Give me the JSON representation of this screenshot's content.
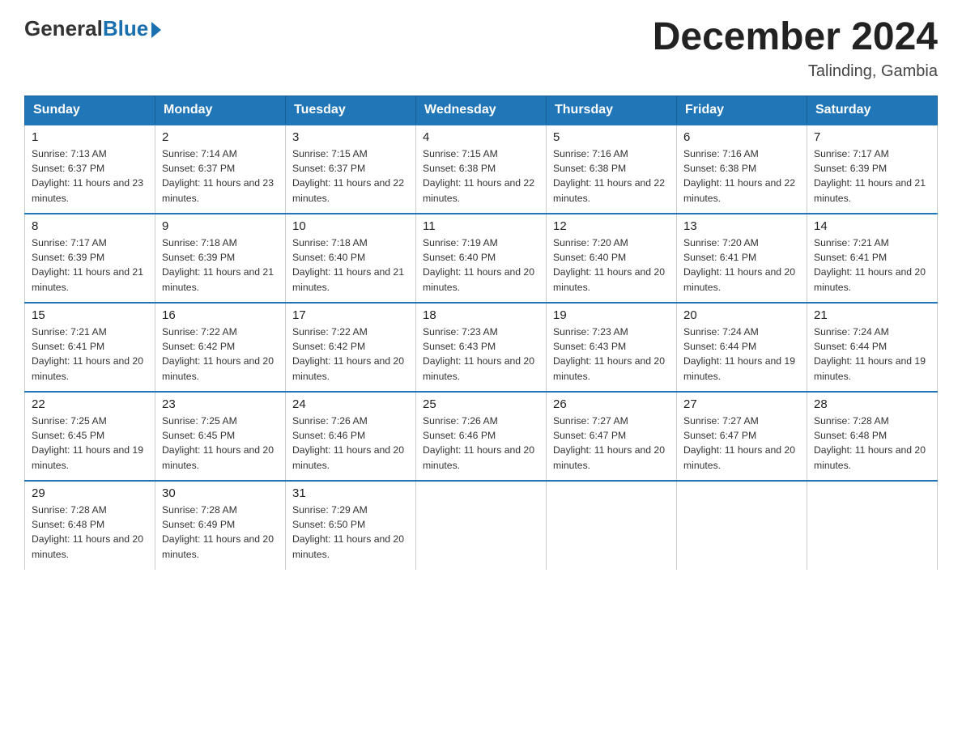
{
  "header": {
    "logo_general": "General",
    "logo_blue": "Blue",
    "month_title": "December 2024",
    "location": "Talinding, Gambia"
  },
  "weekdays": [
    "Sunday",
    "Monday",
    "Tuesday",
    "Wednesday",
    "Thursday",
    "Friday",
    "Saturday"
  ],
  "weeks": [
    [
      {
        "day": "1",
        "sunrise": "7:13 AM",
        "sunset": "6:37 PM",
        "daylight": "11 hours and 23 minutes."
      },
      {
        "day": "2",
        "sunrise": "7:14 AM",
        "sunset": "6:37 PM",
        "daylight": "11 hours and 23 minutes."
      },
      {
        "day": "3",
        "sunrise": "7:15 AM",
        "sunset": "6:37 PM",
        "daylight": "11 hours and 22 minutes."
      },
      {
        "day": "4",
        "sunrise": "7:15 AM",
        "sunset": "6:38 PM",
        "daylight": "11 hours and 22 minutes."
      },
      {
        "day": "5",
        "sunrise": "7:16 AM",
        "sunset": "6:38 PM",
        "daylight": "11 hours and 22 minutes."
      },
      {
        "day": "6",
        "sunrise": "7:16 AM",
        "sunset": "6:38 PM",
        "daylight": "11 hours and 22 minutes."
      },
      {
        "day": "7",
        "sunrise": "7:17 AM",
        "sunset": "6:39 PM",
        "daylight": "11 hours and 21 minutes."
      }
    ],
    [
      {
        "day": "8",
        "sunrise": "7:17 AM",
        "sunset": "6:39 PM",
        "daylight": "11 hours and 21 minutes."
      },
      {
        "day": "9",
        "sunrise": "7:18 AM",
        "sunset": "6:39 PM",
        "daylight": "11 hours and 21 minutes."
      },
      {
        "day": "10",
        "sunrise": "7:18 AM",
        "sunset": "6:40 PM",
        "daylight": "11 hours and 21 minutes."
      },
      {
        "day": "11",
        "sunrise": "7:19 AM",
        "sunset": "6:40 PM",
        "daylight": "11 hours and 20 minutes."
      },
      {
        "day": "12",
        "sunrise": "7:20 AM",
        "sunset": "6:40 PM",
        "daylight": "11 hours and 20 minutes."
      },
      {
        "day": "13",
        "sunrise": "7:20 AM",
        "sunset": "6:41 PM",
        "daylight": "11 hours and 20 minutes."
      },
      {
        "day": "14",
        "sunrise": "7:21 AM",
        "sunset": "6:41 PM",
        "daylight": "11 hours and 20 minutes."
      }
    ],
    [
      {
        "day": "15",
        "sunrise": "7:21 AM",
        "sunset": "6:41 PM",
        "daylight": "11 hours and 20 minutes."
      },
      {
        "day": "16",
        "sunrise": "7:22 AM",
        "sunset": "6:42 PM",
        "daylight": "11 hours and 20 minutes."
      },
      {
        "day": "17",
        "sunrise": "7:22 AM",
        "sunset": "6:42 PM",
        "daylight": "11 hours and 20 minutes."
      },
      {
        "day": "18",
        "sunrise": "7:23 AM",
        "sunset": "6:43 PM",
        "daylight": "11 hours and 20 minutes."
      },
      {
        "day": "19",
        "sunrise": "7:23 AM",
        "sunset": "6:43 PM",
        "daylight": "11 hours and 20 minutes."
      },
      {
        "day": "20",
        "sunrise": "7:24 AM",
        "sunset": "6:44 PM",
        "daylight": "11 hours and 19 minutes."
      },
      {
        "day": "21",
        "sunrise": "7:24 AM",
        "sunset": "6:44 PM",
        "daylight": "11 hours and 19 minutes."
      }
    ],
    [
      {
        "day": "22",
        "sunrise": "7:25 AM",
        "sunset": "6:45 PM",
        "daylight": "11 hours and 19 minutes."
      },
      {
        "day": "23",
        "sunrise": "7:25 AM",
        "sunset": "6:45 PM",
        "daylight": "11 hours and 20 minutes."
      },
      {
        "day": "24",
        "sunrise": "7:26 AM",
        "sunset": "6:46 PM",
        "daylight": "11 hours and 20 minutes."
      },
      {
        "day": "25",
        "sunrise": "7:26 AM",
        "sunset": "6:46 PM",
        "daylight": "11 hours and 20 minutes."
      },
      {
        "day": "26",
        "sunrise": "7:27 AM",
        "sunset": "6:47 PM",
        "daylight": "11 hours and 20 minutes."
      },
      {
        "day": "27",
        "sunrise": "7:27 AM",
        "sunset": "6:47 PM",
        "daylight": "11 hours and 20 minutes."
      },
      {
        "day": "28",
        "sunrise": "7:28 AM",
        "sunset": "6:48 PM",
        "daylight": "11 hours and 20 minutes."
      }
    ],
    [
      {
        "day": "29",
        "sunrise": "7:28 AM",
        "sunset": "6:48 PM",
        "daylight": "11 hours and 20 minutes."
      },
      {
        "day": "30",
        "sunrise": "7:28 AM",
        "sunset": "6:49 PM",
        "daylight": "11 hours and 20 minutes."
      },
      {
        "day": "31",
        "sunrise": "7:29 AM",
        "sunset": "6:50 PM",
        "daylight": "11 hours and 20 minutes."
      },
      null,
      null,
      null,
      null
    ]
  ]
}
